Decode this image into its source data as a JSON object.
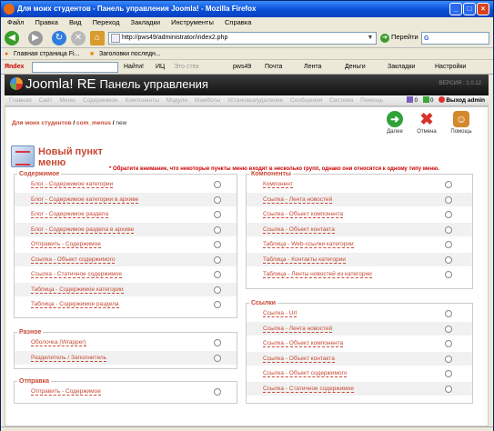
{
  "window": {
    "title": "Для моих студентов - Панель управления Joomla! - Mozilla Firefox"
  },
  "menubar": [
    "Файл",
    "Правка",
    "Вид",
    "Переход",
    "Закладки",
    "Инструменты",
    "Справка"
  ],
  "nav": {
    "url": "http://pws49/administrator/index2.php",
    "go_label": "Перейти",
    "search_placeholder": ""
  },
  "bookmarks": [
    "Главная страница Fi...",
    "Заголовки последн..."
  ],
  "yandex": {
    "logo": "Яndex",
    "find": "Найти!",
    "items": [
      "ИЦ",
      "Это стек",
      "pws49",
      "Почта",
      "Лента",
      "Деньги",
      "Закладки",
      "Настройки"
    ]
  },
  "joomla": {
    "logo": "Joomla! RE",
    "panel_title": "Панель управления",
    "version": "ВЕРСИЯ : 1.0.12"
  },
  "admin_menu": {
    "items": [
      "Главная",
      "Сайт",
      "Меню",
      "Содержимое",
      "Компоненты",
      "Модули",
      "Мамботы",
      "Установка/удаление",
      "Сообщения",
      "Система",
      "Помощь"
    ],
    "count1": "0",
    "count2": "0",
    "logout": "Выход admin"
  },
  "breadcrumb": {
    "site": "Для моих студентов",
    "sep1": " / ",
    "component": "com_menus",
    "sep2": " / ",
    "current": "new"
  },
  "toolbar": {
    "next": "Далее",
    "cancel": "Отмена",
    "help": "Помощь"
  },
  "page": {
    "title": "Новый пункт меню",
    "notice": "* Обратите внимание, что некоторые пункты меню входят в несколько групп, однако они относятся к одному типу меню."
  },
  "groups": {
    "content": {
      "legend": "Содержимое",
      "items": [
        "Блог - Содержимое категории",
        "Блог - Содержимое категории в архиве",
        "Блог - Содержимое раздела",
        "Блог - Содержимое раздела в архиве",
        "Отправить - Содержимое",
        "Ссылка - Объект содержимого",
        "Ссылка - Статичное содержимое",
        "Таблица - Содержимое категории",
        "Таблица - Содержимое раздела"
      ]
    },
    "misc": {
      "legend": "Разное",
      "items": [
        "Оболочка (Wrapper)",
        "Разделитель / Заполнитель"
      ]
    },
    "submit": {
      "legend": "Отправка",
      "items": [
        "Отправить - Содержимое"
      ]
    },
    "components": {
      "legend": "Компоненты",
      "items": [
        "Компонент",
        "Ссылка - Лента новостей",
        "Ссылка - Объект компонента",
        "Ссылка - Объект контакта",
        "Таблица - Web-ссылки категории",
        "Таблица - Контакты категории",
        "Таблица - Ленты новостей из категории"
      ]
    },
    "links": {
      "legend": "Ссылки",
      "items": [
        "Ссылка - Url",
        "Ссылка - Лента новостей",
        "Ссылка - Объект компонента",
        "Ссылка - Объект контакта",
        "Ссылка - Объект содержимого",
        "Ссылка - Статичное содержимое"
      ]
    }
  },
  "colors": {
    "accent": "#c64934",
    "titlebar": "#0a4fd6",
    "notice": "#cc0000"
  }
}
